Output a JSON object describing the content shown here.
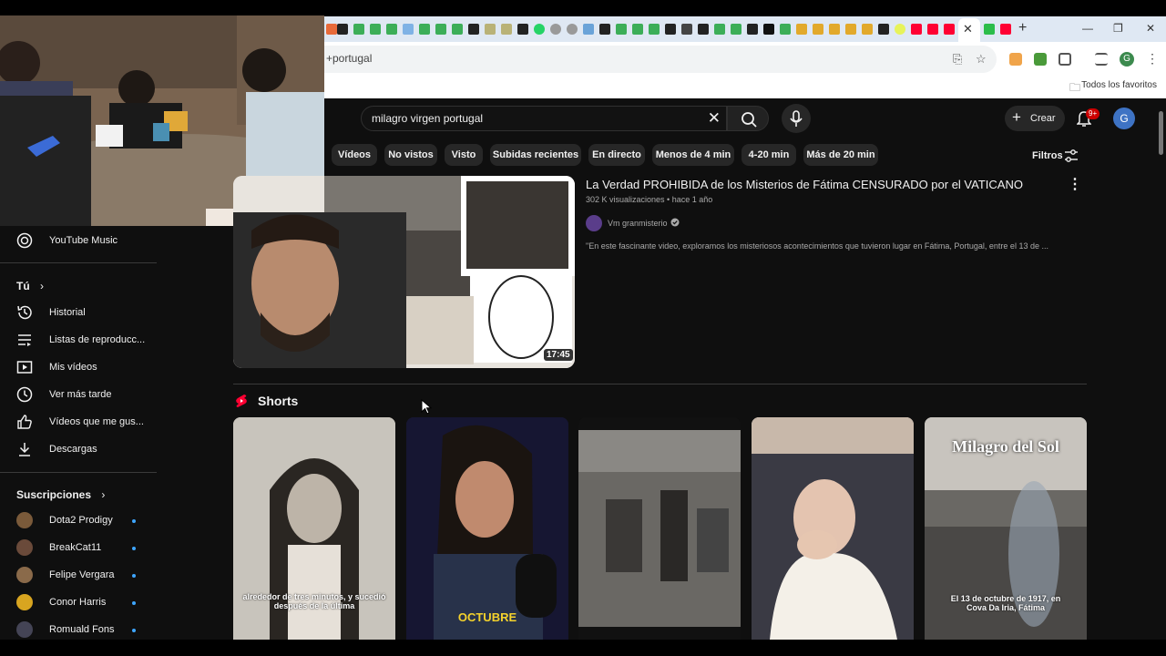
{
  "browser": {
    "address_text": "+portugal",
    "all_bookmarks_label": "Todos los favoritos",
    "profile_initial": "G"
  },
  "header": {
    "search_query": "milagro virgen portugal",
    "create_label": "Crear",
    "notifications_badge": "9+",
    "avatar_initial": "G"
  },
  "chips": [
    "Vídeos",
    "No vistos",
    "Visto",
    "Subidas recientes",
    "En directo",
    "Menos de 4 min",
    "4-20 min",
    "Más de 20 min"
  ],
  "filters_label": "Filtros",
  "sidebar": {
    "music_label": "YouTube Music",
    "you_heading": "Tú",
    "you_items": [
      {
        "label": "Historial",
        "icon": "history-icon"
      },
      {
        "label": "Listas de reproducc...",
        "icon": "playlist-icon"
      },
      {
        "label": "Mis vídeos",
        "icon": "my-videos-icon"
      },
      {
        "label": "Ver más tarde",
        "icon": "watch-later-icon"
      },
      {
        "label": "Vídeos que me gus...",
        "icon": "thumb-up-icon"
      },
      {
        "label": "Descargas",
        "icon": "download-icon"
      }
    ],
    "subs_heading": "Suscripciones",
    "subscriptions": [
      "Dota2 Prodigy",
      "BreakCat11",
      "Felipe Vergara",
      "Conor Harris",
      "Romuald Fons"
    ]
  },
  "video": {
    "title": "La Verdad PROHIBIDA de los Misterios de Fátima CENSURADO por el VATICANO",
    "meta": "302 K visualizaciones • hace 1 año",
    "channel": "Vm granmisterio",
    "description": "\"En este fascinante video, exploramos los misteriosos acontecimientos que tuvieron lugar en Fátima, Portugal, entre el 13 de ...",
    "duration": "17:45"
  },
  "shorts": {
    "heading": "Shorts",
    "items": [
      {
        "caption": "alrededor de tres minutos, y sucedió después de la última"
      },
      {
        "caption": "OCTUBRE"
      },
      {
        "caption": ""
      },
      {
        "caption": ""
      },
      {
        "title": "Milagro del Sol",
        "caption": "El 13 de octubre de 1917, en Cova Da Iria, Fátima"
      }
    ]
  },
  "colors": {
    "background": "#0f0f0f",
    "accent_red": "#ff0033",
    "link_blue": "#3ea6ff"
  }
}
